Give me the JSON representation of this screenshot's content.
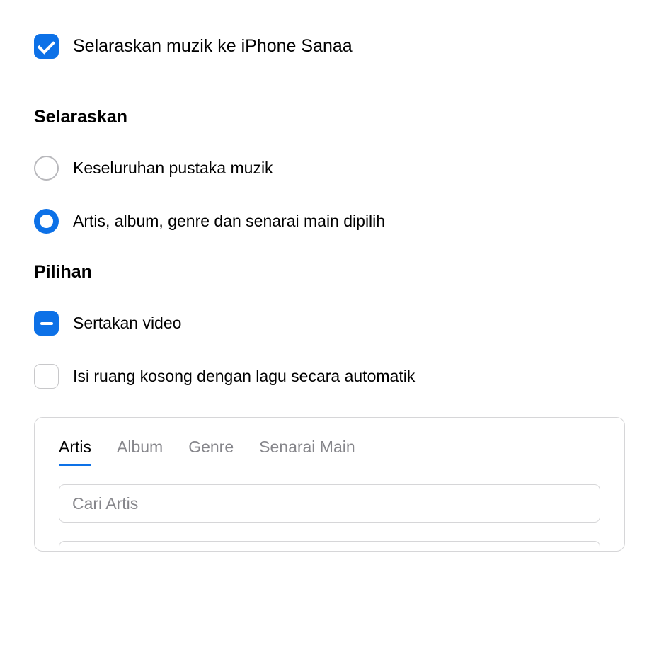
{
  "sync": {
    "main_checkbox_label": "Selaraskan muzik ke iPhone Sanaa",
    "heading": "Selaraskan",
    "radio_entire": "Keseluruhan pustaka muzik",
    "radio_selected": "Artis, album, genre dan senarai main dipilih"
  },
  "options": {
    "heading": "Pilihan",
    "include_videos": "Sertakan video",
    "autofill": "Isi ruang kosong dengan lagu secara automatik"
  },
  "panel": {
    "tabs": {
      "artists": "Artis",
      "albums": "Album",
      "genres": "Genre",
      "playlists": "Senarai Main"
    },
    "search_placeholder": "Cari Artis"
  }
}
